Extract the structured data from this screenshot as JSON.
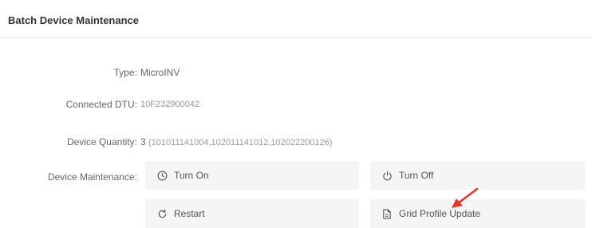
{
  "header": {
    "title": "Batch Device Maintenance"
  },
  "fields": {
    "type_label": "Type:",
    "type_value": "MicroINV",
    "dtu_label": "Connected DTU:",
    "dtu_value": "10F232900042",
    "qty_label": "Device Quantity:",
    "qty_count": "3",
    "qty_ids": "(101011141004,102011141012,102022200126)",
    "maint_label": "Device Maintenance:"
  },
  "actions": {
    "turn_on": "Turn On",
    "turn_off": "Turn Off",
    "restart": "Restart",
    "grid_profile_update": "Grid Profile Update"
  },
  "colors": {
    "annotation_arrow": "#e8322b",
    "button_bg": "#f5f5f5"
  },
  "icons": {
    "turn_on": "clock-icon",
    "turn_off": "power-icon",
    "restart": "refresh-icon",
    "grid_profile_update": "document-icon"
  }
}
